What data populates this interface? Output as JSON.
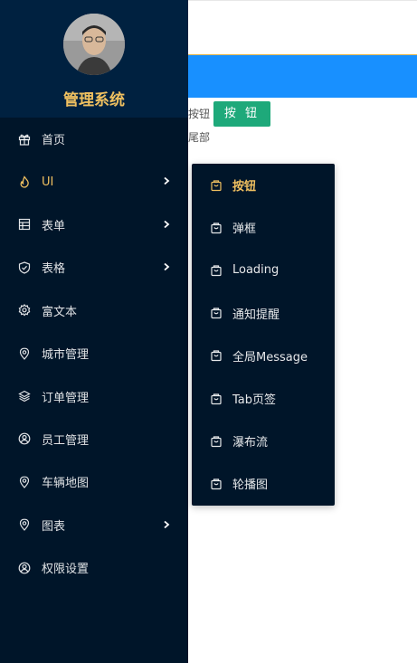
{
  "brand": {
    "title": "管理系统"
  },
  "menu": [
    {
      "label": "首页",
      "icon": "gift-icon",
      "has_submenu": false
    },
    {
      "label": "UI",
      "icon": "fire-icon",
      "has_submenu": true,
      "active": true
    },
    {
      "label": "表单",
      "icon": "table-icon",
      "has_submenu": true
    },
    {
      "label": "表格",
      "icon": "shield-check-icon",
      "has_submenu": true
    },
    {
      "label": "富文本",
      "icon": "gear-icon",
      "has_submenu": false
    },
    {
      "label": "城市管理",
      "icon": "location-icon",
      "has_submenu": false
    },
    {
      "label": "订单管理",
      "icon": "layers-icon",
      "has_submenu": false
    },
    {
      "label": "员工管理",
      "icon": "user-circle-icon",
      "has_submenu": false
    },
    {
      "label": "车辆地图",
      "icon": "location-icon",
      "has_submenu": false
    },
    {
      "label": "图表",
      "icon": "location-icon",
      "has_submenu": true
    },
    {
      "label": "权限设置",
      "icon": "user-circle-icon",
      "has_submenu": false
    }
  ],
  "submenu": [
    {
      "label": "按钮",
      "icon": "shopping-bag-icon",
      "active": true
    },
    {
      "label": "弹框",
      "icon": "shopping-bag-icon"
    },
    {
      "label": "Loading",
      "icon": "shopping-bag-icon"
    },
    {
      "label": "通知提醒",
      "icon": "shopping-bag-icon"
    },
    {
      "label": "全局Message",
      "icon": "shopping-bag-icon"
    },
    {
      "label": "Tab页签",
      "icon": "shopping-bag-icon"
    },
    {
      "label": "瀑布流",
      "icon": "shopping-bag-icon"
    },
    {
      "label": "轮播图",
      "icon": "shopping-bag-icon"
    }
  ],
  "content": {
    "button_text_label": "按钮",
    "green_button_label": "按 钮",
    "footer_label": "尾部"
  },
  "colors": {
    "sidebar_bg": "#001529",
    "header_bg": "#002140",
    "accent": "#f0c060",
    "blue_bar": "#1890ff",
    "green_button": "#1ea97a"
  }
}
